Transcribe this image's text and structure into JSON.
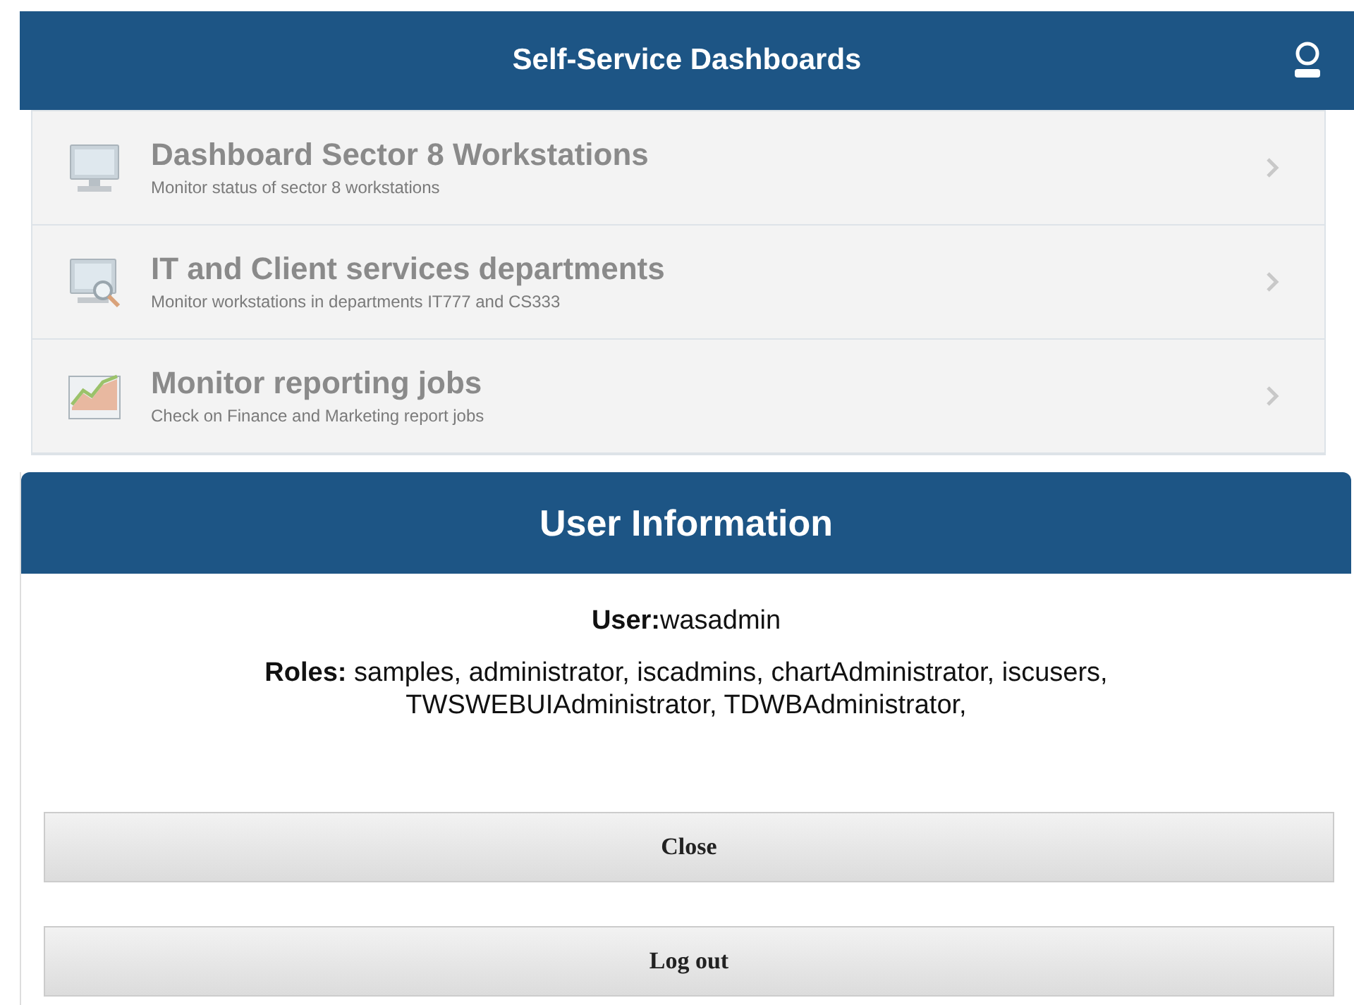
{
  "header": {
    "title": "Self-Service Dashboards"
  },
  "dashboards": [
    {
      "kind": "monitor",
      "title": "Dashboard Sector 8 Workstations",
      "subtitle": "Monitor status of sector 8 workstations"
    },
    {
      "kind": "search",
      "title": "IT and Client services departments",
      "subtitle": "Monitor workstations in departments IT777 and CS333"
    },
    {
      "kind": "chart",
      "title": "Monitor reporting jobs",
      "subtitle": "Check on Finance and Marketing report jobs"
    }
  ],
  "dialog": {
    "title": "User Information",
    "user_label": "User:",
    "user": "wasadmin",
    "roles_label": "Roles:",
    "roles": "samples, administrator, iscadmins, chartAdministrator, iscusers, TWSWEBUIAdministrator, TDWBAdministrator,",
    "buttons": [
      "Close",
      "Log out"
    ]
  }
}
